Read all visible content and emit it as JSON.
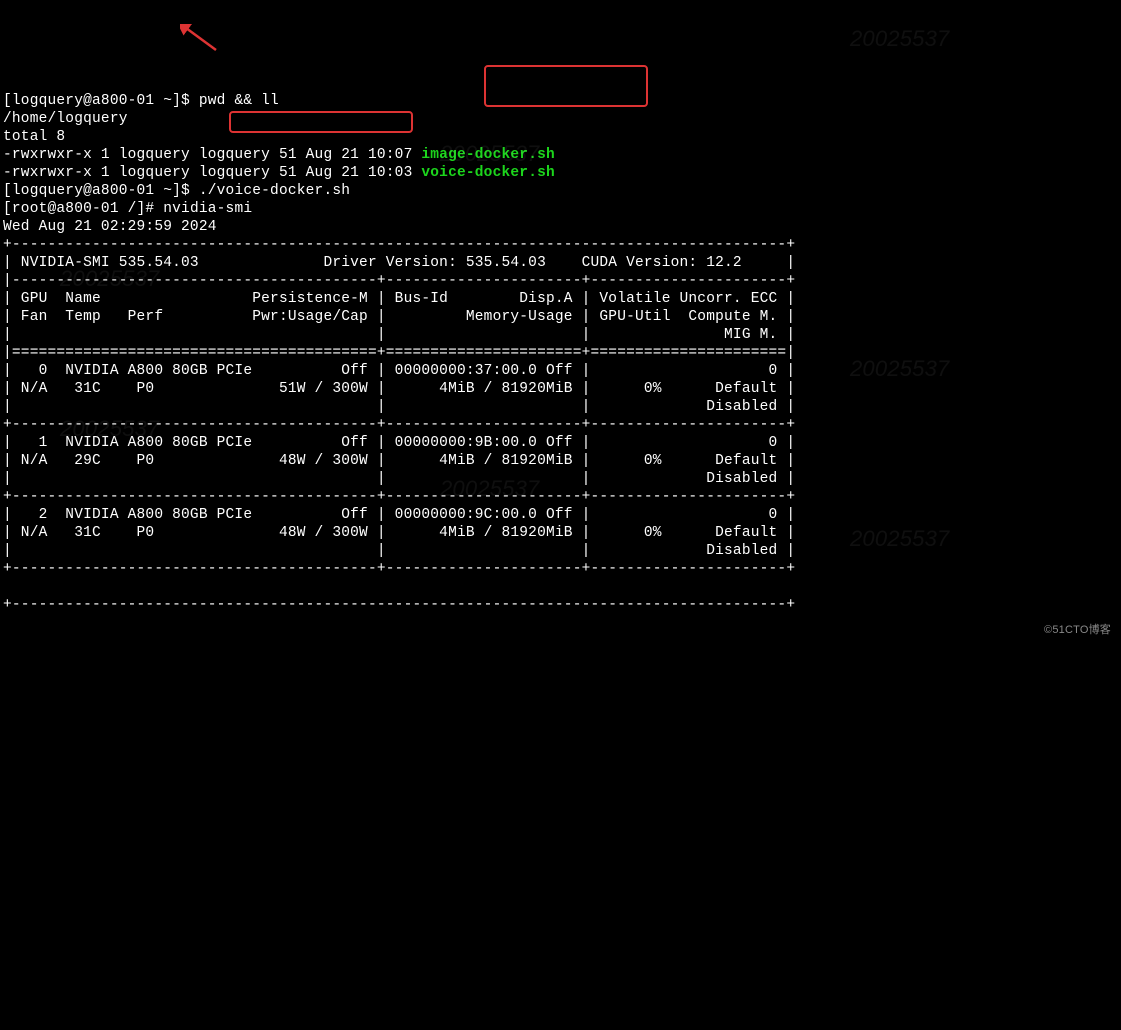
{
  "prompt1_user": "[logquery@a800-01 ~]$ ",
  "cmd1": "pwd && ll",
  "pwd_out": "/home/logquery",
  "total_line": "total 8",
  "ls1_attr": "-rwxrwxr-x 1 logquery logquery 51 Aug 21 10:07 ",
  "ls1_file": "image-docker.sh",
  "ls2_attr": "-rwxrwxr-x 1 logquery logquery 51 Aug 21 10:03 ",
  "ls2_file": "voice-docker.sh",
  "prompt2_user": "[logquery@a800-01 ~]$ ",
  "cmd2": "./voice-docker.sh",
  "prompt3_root": "[root@a800-01 /]# ",
  "cmd3": "nvidia-smi",
  "date_line": "Wed Aug 21 02:29:59 2024",
  "smi": {
    "top": "+---------------------------------------------------------------------------------------+",
    "hdr": "| NVIDIA-SMI 535.54.03              Driver Version: 535.54.03    CUDA Version: 12.2     |",
    "mid": "|-----------------------------------------+----------------------+----------------------+",
    "col1": "| GPU  Name                 Persistence-M | Bus-Id        Disp.A | Volatile Uncorr. ECC |",
    "col2": "| Fan  Temp   Perf          Pwr:Usage/Cap |         Memory-Usage | GPU-Util  Compute M. |",
    "col3": "|                                         |                      |               MIG M. |",
    "eq": "|=========================================+======================+======================|",
    "g0a": "|   0  NVIDIA A800 80GB PCIe          Off | 00000000:37:00.0 Off |                    0 |",
    "g0b": "| N/A   31C    P0              51W / 300W |      4MiB / 81920MiB |      0%      Default |",
    "g0c": "|                                         |                      |             Disabled |",
    "sep": "+-----------------------------------------+----------------------+----------------------+",
    "g1a": "|   1  NVIDIA A800 80GB PCIe          Off | 00000000:9B:00.0 Off |                    0 |",
    "g1b": "| N/A   29C    P0              48W / 300W |      4MiB / 81920MiB |      0%      Default |",
    "g1c": "|                                         |                      |             Disabled |",
    "g2a": "|   2  NVIDIA A800 80GB PCIe          Off | 00000000:9C:00.0 Off |                    0 |",
    "g2b": "| N/A   31C    P0              48W / 300W |      4MiB / 81920MiB |      0%      Default |",
    "g2c": "|                                         |                      |             Disabled |",
    "blank": "                                                                                          "
  },
  "watermark": "20025537",
  "source": "©51CTO博客"
}
